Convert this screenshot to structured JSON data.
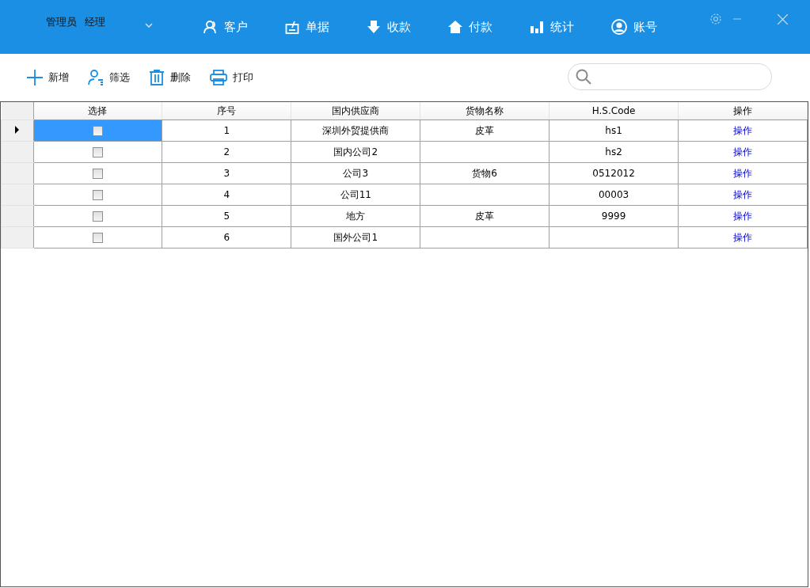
{
  "user": {
    "role": "管理员",
    "name": "经理"
  },
  "nav": [
    {
      "label": "客户"
    },
    {
      "label": "单据"
    },
    {
      "label": "收款"
    },
    {
      "label": "付款"
    },
    {
      "label": "统计"
    },
    {
      "label": "账号"
    }
  ],
  "toolbar": [
    {
      "label": "新增"
    },
    {
      "label": "筛选"
    },
    {
      "label": "删除"
    },
    {
      "label": "打印"
    }
  ],
  "table": {
    "columns": [
      "选择",
      "序号",
      "国内供应商",
      "货物名称",
      "H.S.Code",
      "操作"
    ],
    "rows": [
      {
        "selected": true,
        "checked": false,
        "no": "1",
        "supplier": "深圳外贸提供商",
        "goods": "皮革",
        "hs_code": "hs1",
        "action": "操作"
      },
      {
        "selected": false,
        "checked": false,
        "no": "2",
        "supplier": "国内公司2",
        "hs_code": "hs2",
        "action": "操作"
      },
      {
        "selected": false,
        "checked": false,
        "no": "3",
        "supplier": "公司3",
        "goods": "货物6",
        "hs_code": "0512012",
        "action": "操作"
      },
      {
        "selected": false,
        "checked": false,
        "no": "4",
        "supplier": "公司11",
        "hs_code": "00003",
        "action": "操作"
      },
      {
        "selected": false,
        "checked": false,
        "no": "5",
        "supplier": "地方",
        "goods": "皮革",
        "hs_code": "9999",
        "action": "操作"
      },
      {
        "selected": false,
        "checked": false,
        "no": "6",
        "supplier": "国外公司1",
        "action": "操作"
      }
    ]
  }
}
